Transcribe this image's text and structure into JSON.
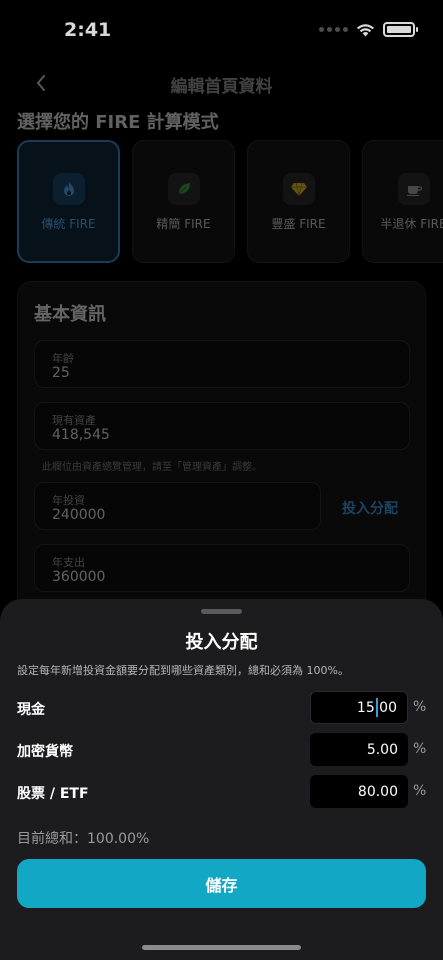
{
  "status": {
    "time": "2:41"
  },
  "nav": {
    "title": "編輯首頁資料"
  },
  "section": {
    "title": "選擇您的 FIRE 計算模式"
  },
  "modes": [
    {
      "label": "傳統 FIRE",
      "icon": "flame-icon",
      "active": true
    },
    {
      "label": "精簡 FIRE",
      "icon": "leaf-icon",
      "active": false
    },
    {
      "label": "豐盛 FIRE",
      "icon": "diamond-icon",
      "active": false
    },
    {
      "label": "半退休 FIRE",
      "icon": "coffee-icon",
      "active": false
    }
  ],
  "basic": {
    "title": "基本資訊",
    "age": {
      "label": "年齡",
      "value": "25"
    },
    "assets": {
      "label": "現有資產",
      "value": "418,545"
    },
    "hint": "此欄位由資產總覽管理，請至「管理資產」調整。",
    "investment": {
      "label": "年投資",
      "value": "240000"
    },
    "allocation_link": "投入分配",
    "expense": {
      "label": "年支出",
      "value": "360000"
    }
  },
  "sheet": {
    "title": "投入分配",
    "description": "設定每年新增投資金額要分配到哪些資產類別，總和必須為 100%。",
    "rows": [
      {
        "label": "現金",
        "value": "15.00",
        "unit": "%"
      },
      {
        "label": "加密貨幣",
        "value": "5.00",
        "unit": "%"
      },
      {
        "label": "股票 / ETF",
        "value": "80.00",
        "unit": "%"
      }
    ],
    "total": "目前總和：100.00%",
    "save_label": "儲存"
  },
  "colors": {
    "accent": "#12a7c4",
    "link": "#3f8fd0",
    "active_border": "#3b7fb8"
  }
}
